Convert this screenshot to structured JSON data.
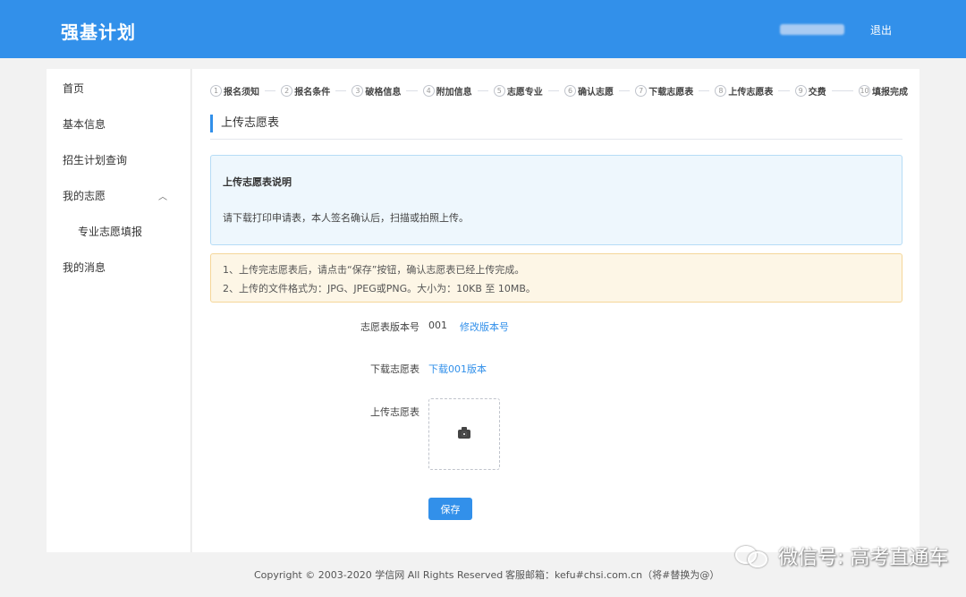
{
  "header": {
    "brand": "强基计划",
    "logout_label": "退出"
  },
  "sidebar": {
    "items": [
      {
        "label": "首页"
      },
      {
        "label": "基本信息"
      },
      {
        "label": "招生计划查询"
      },
      {
        "label": "我的志愿"
      },
      {
        "label": "专业志愿填报"
      },
      {
        "label": "我的消息"
      }
    ],
    "expand_icon": "chevron-up-icon"
  },
  "steps": [
    {
      "num": "1",
      "label": "报名须知"
    },
    {
      "num": "2",
      "label": "报名条件"
    },
    {
      "num": "3",
      "label": "破格信息"
    },
    {
      "num": "4",
      "label": "附加信息"
    },
    {
      "num": "5",
      "label": "志愿专业"
    },
    {
      "num": "6",
      "label": "确认志愿"
    },
    {
      "num": "7",
      "label": "下载志愿表"
    },
    {
      "num": "8",
      "label": "上传志愿表"
    },
    {
      "num": "9",
      "label": "交费"
    },
    {
      "num": "10",
      "label": "填报完成"
    }
  ],
  "section_title": "上传志愿表",
  "info": {
    "title": "上传志愿表说明",
    "text": "请下载打印申请表，本人签名确认后，扫描或拍照上传。"
  },
  "notice": {
    "line1": "1、上传完志愿表后，请点击“保存”按钮，确认志愿表已经上传完成。",
    "line2": "2、上传的文件格式为：JPG、JPEG或PNG。大小为：10KB 至 10MB。"
  },
  "form": {
    "version_label": "志愿表版本号",
    "version_value": "001",
    "modify_version_link": "修改版本号",
    "download_label": "下载志愿表",
    "download_link": "下载001版本",
    "upload_label": "上传志愿表",
    "upload_icon": "camera-icon",
    "save_label": "保存"
  },
  "footer": {
    "copyright": "Copyright © 2003-2020 学信网 All Rights Reserved",
    "service": "客服邮箱：kefu#chsi.com.cn（将#替换为@）"
  },
  "watermark": {
    "text": "微信号: 高考直通车"
  },
  "colors": {
    "primary": "#3290ea",
    "info_bg": "#eef7fd",
    "warn_bg": "#fdf6e6"
  }
}
